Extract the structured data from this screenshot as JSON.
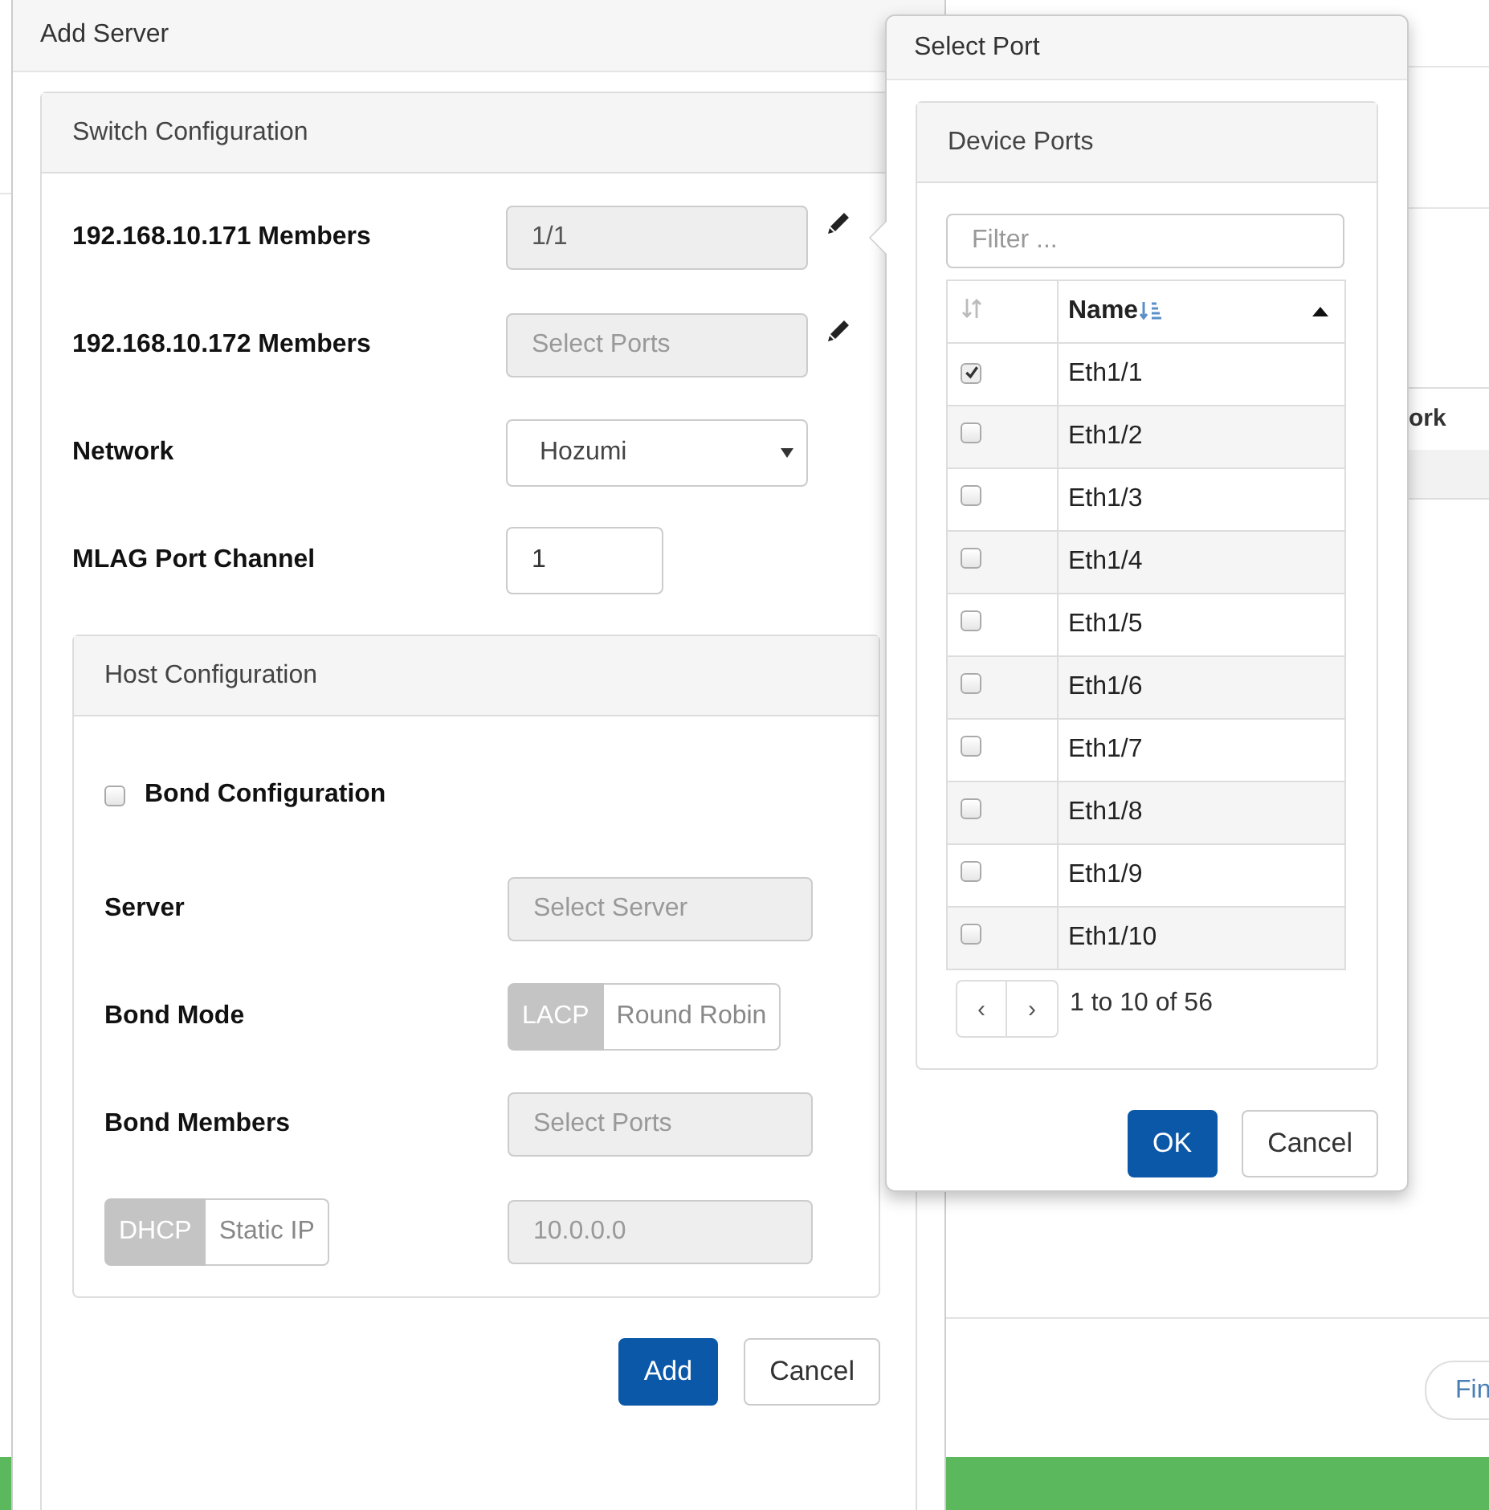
{
  "background": {
    "table_header": "ork",
    "find_button": "Fin"
  },
  "add_server": {
    "title": "Add Server",
    "switch_configuration": {
      "title": "Switch Configuration",
      "rows": [
        {
          "label": "192.168.10.171 Members",
          "kind": "ports",
          "value": "1/1"
        },
        {
          "label": "192.168.10.172 Members",
          "kind": "ports",
          "placeholder": "Select Ports"
        },
        {
          "label": "Network",
          "kind": "select",
          "value": "Hozumi"
        },
        {
          "label": "MLAG Port Channel",
          "kind": "number",
          "value": "1"
        }
      ]
    },
    "host_configuration": {
      "title": "Host Configuration",
      "bond_configuration": {
        "label": "Bond Configuration",
        "checked": false
      },
      "server": {
        "label": "Server",
        "placeholder": "Select Server"
      },
      "bond_mode": {
        "label": "Bond Mode",
        "options": [
          {
            "label": "LACP",
            "selected": true
          },
          {
            "label": "Round Robin",
            "selected": false
          }
        ]
      },
      "bond_members": {
        "label": "Bond Members",
        "placeholder": "Select Ports"
      },
      "ip_mode": {
        "options": [
          {
            "label": "DHCP",
            "selected": true
          },
          {
            "label": "Static IP",
            "selected": false
          }
        ],
        "placeholder": "10.0.0.0"
      }
    },
    "buttons": [
      {
        "label": "Add",
        "kind": "primary"
      },
      {
        "label": "Cancel",
        "kind": "default"
      }
    ]
  },
  "select_port": {
    "title": "Select Port",
    "panel_title": "Device Ports",
    "filter": {
      "placeholder": "Filter ..."
    },
    "table": {
      "columns": [
        "Name"
      ],
      "rows": [
        {
          "name": "Eth1/1",
          "checked": true
        },
        {
          "name": "Eth1/2",
          "checked": false
        },
        {
          "name": "Eth1/3",
          "checked": false
        },
        {
          "name": "Eth1/4",
          "checked": false
        },
        {
          "name": "Eth1/5",
          "checked": false
        },
        {
          "name": "Eth1/6",
          "checked": false
        },
        {
          "name": "Eth1/7",
          "checked": false
        },
        {
          "name": "Eth1/8",
          "checked": false
        },
        {
          "name": "Eth1/9",
          "checked": false
        },
        {
          "name": "Eth1/10",
          "checked": false
        }
      ]
    },
    "pager": {
      "prev": "‹",
      "next": "›",
      "summary": "1 to 10 of 56"
    },
    "buttons": [
      {
        "label": "OK",
        "kind": "primary"
      },
      {
        "label": "Cancel",
        "kind": "default"
      }
    ]
  }
}
